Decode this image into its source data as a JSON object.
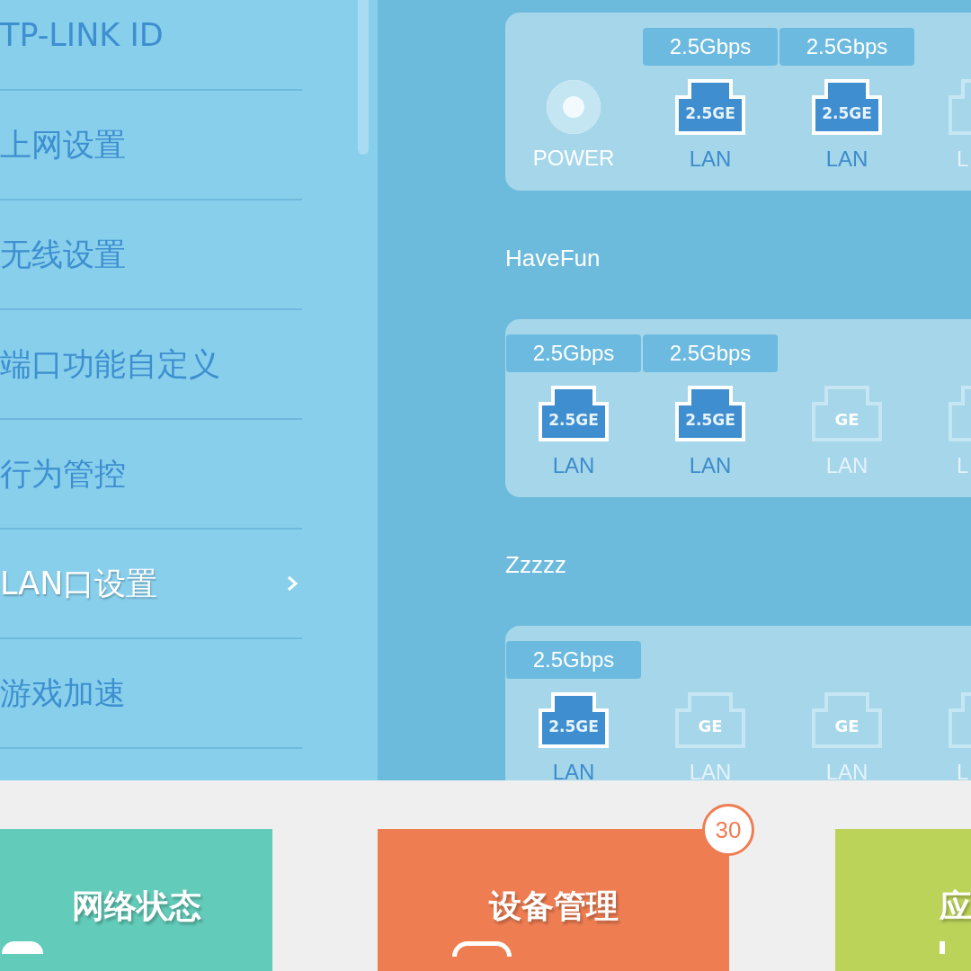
{
  "sidebar": {
    "items": [
      {
        "label": "TP-LINK ID",
        "selected": false
      },
      {
        "label": "上网设置",
        "selected": false
      },
      {
        "label": "无线设置",
        "selected": false
      },
      {
        "label": "端口功能自定义",
        "selected": false
      },
      {
        "label": "行为管控",
        "selected": false
      },
      {
        "label": "LAN口设置",
        "selected": true
      },
      {
        "label": "游戏加速",
        "selected": false
      }
    ]
  },
  "port_groups": [
    {
      "ports": [
        {
          "kind": "power",
          "label": "POWER"
        },
        {
          "kind": "port",
          "active": true,
          "speed": "2.5Gbps",
          "icon_text": "2.5GE",
          "label": "LAN"
        },
        {
          "kind": "port",
          "active": true,
          "speed": "2.5Gbps",
          "icon_text": "2.5GE",
          "label": "LAN"
        },
        {
          "kind": "port",
          "active": false,
          "cut": true,
          "label": "L"
        }
      ]
    },
    {
      "name": "HaveFun",
      "ports": [
        {
          "kind": "port",
          "active": true,
          "speed": "2.5Gbps",
          "icon_text": "2.5GE",
          "label": "LAN"
        },
        {
          "kind": "port",
          "active": true,
          "speed": "2.5Gbps",
          "icon_text": "2.5GE",
          "label": "LAN"
        },
        {
          "kind": "port",
          "active": false,
          "icon_text": "GE",
          "label": "LAN"
        },
        {
          "kind": "port",
          "active": false,
          "cut": true,
          "label": "L"
        }
      ]
    },
    {
      "name": "Zzzzz",
      "ports": [
        {
          "kind": "port",
          "active": true,
          "speed": "2.5Gbps",
          "icon_text": "2.5GE",
          "label": "LAN"
        },
        {
          "kind": "port",
          "active": false,
          "icon_text": "GE",
          "label": "LAN"
        },
        {
          "kind": "port",
          "active": false,
          "icon_text": "GE",
          "label": "LAN"
        },
        {
          "kind": "port",
          "active": false,
          "cut": true,
          "label": "L"
        }
      ]
    }
  ],
  "tiles": [
    {
      "label": "网络状态",
      "color": "#62cbb9"
    },
    {
      "label": "设备管理",
      "color": "#ee7d52",
      "badge": "30"
    },
    {
      "label": "应",
      "color": "#bcd35a"
    }
  ]
}
